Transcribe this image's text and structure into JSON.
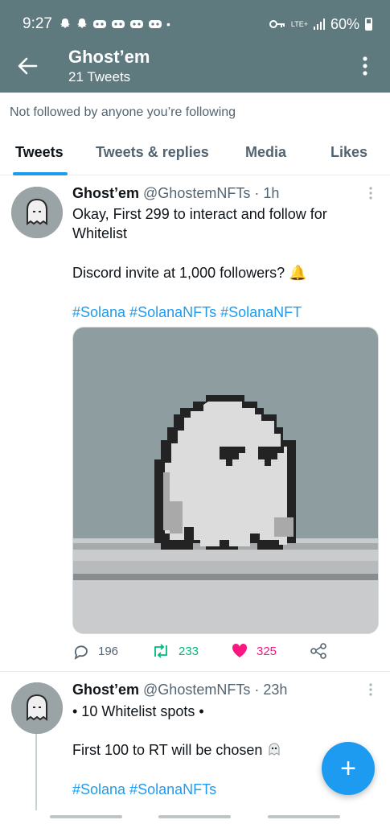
{
  "status": {
    "time": "9:27",
    "network": "LTE+",
    "battery": "60%"
  },
  "header": {
    "title": "Ghost’em",
    "subtitle": "21 Tweets"
  },
  "notice": "Not followed by anyone you’re following",
  "tabs": [
    {
      "label": "Tweets",
      "active": true
    },
    {
      "label": "Tweets & replies",
      "active": false
    },
    {
      "label": "Media",
      "active": false
    },
    {
      "label": "Likes",
      "active": false
    }
  ],
  "tweets": [
    {
      "name": "Ghost’em",
      "handle": "@GhostemNFTs · 1h",
      "line1": "Okay, First 299 to interact and follow for",
      "line2": "Whitelist",
      "line3": "Discord invite at 1,000 followers?",
      "emoji": "🔔",
      "tags": "#Solana #SolanaNFTs #SolanaNFT",
      "replies": "196",
      "retweets": "233",
      "likes": "325"
    },
    {
      "name": "Ghost’em",
      "handle": "@GhostemNFTs · 23h",
      "line1": "• 10 Whitelist spots •",
      "line2": "First 100 to RT will be chosen",
      "tags": "#Solana #SolanaNFTs"
    }
  ],
  "fab": "+",
  "colors": {
    "header": "#5f7a7f",
    "accent": "#1d9bf0",
    "retweet": "#00ba7c",
    "like": "#f91880"
  }
}
